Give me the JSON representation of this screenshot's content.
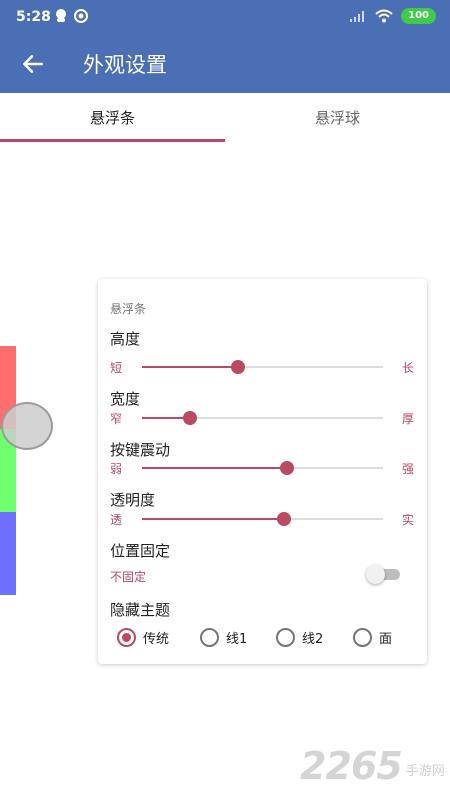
{
  "status_bar": {
    "time": "5:28",
    "battery": "100"
  },
  "app_bar": {
    "title": "外观设置"
  },
  "tabs": [
    {
      "label": "悬浮条"
    },
    {
      "label": "悬浮球"
    }
  ],
  "float_bar_preview": {
    "colors": [
      "#ff6d6d",
      "#6eff6e",
      "#6e6eff"
    ]
  },
  "card": {
    "title": "悬浮条",
    "sliders": [
      {
        "label": "高度",
        "min_label": "短",
        "max_label": "长",
        "value": 0.4
      },
      {
        "label": "宽度",
        "min_label": "窄",
        "max_label": "厚",
        "value": 0.2
      },
      {
        "label": "按键震动",
        "min_label": "弱",
        "max_label": "强",
        "value": 0.6
      },
      {
        "label": "透明度",
        "min_label": "透",
        "max_label": "实",
        "value": 0.59
      }
    ],
    "position_lock": {
      "label": "位置固定",
      "status": "不固定",
      "on": false
    },
    "hide_theme": {
      "label": "隐藏主题",
      "options": [
        "传统",
        "线1",
        "线2",
        "面"
      ],
      "selected": 0
    }
  },
  "accent_color": "#b94a62",
  "header_color": "#4a6fb5",
  "watermark": {
    "number": "2265",
    "sub": "手游网"
  }
}
